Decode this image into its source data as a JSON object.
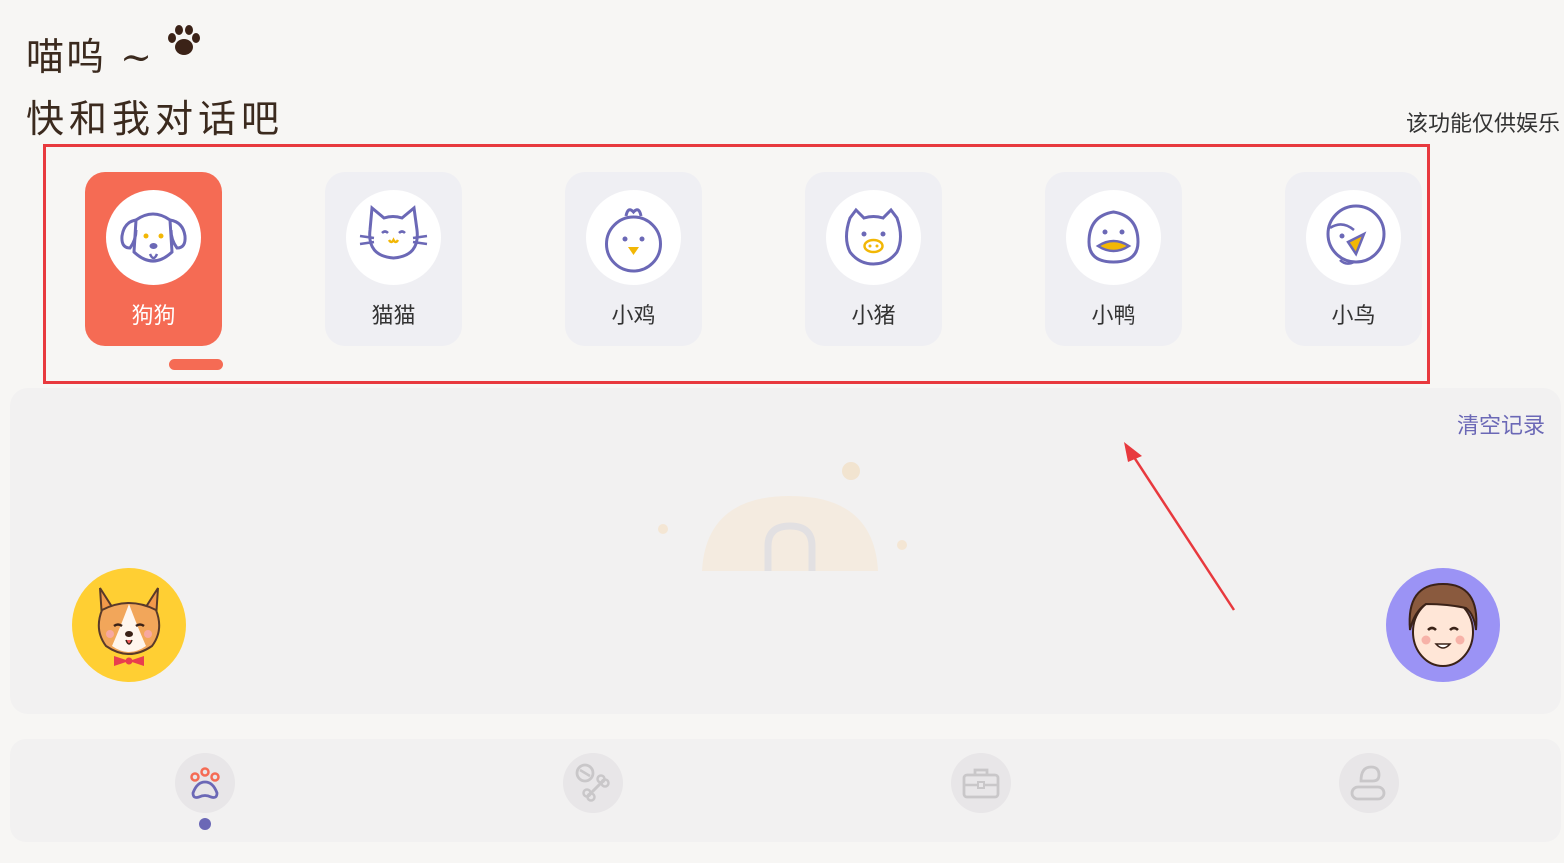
{
  "header": {
    "greeting_line1": "喵呜 ~",
    "greeting_line2": "快和我对话吧",
    "paw_icon": "paw-icon",
    "disclaimer": "该功能仅供娱乐"
  },
  "animals": [
    {
      "label": "狗狗",
      "icon": "dog-icon",
      "selected": true
    },
    {
      "label": "猫猫",
      "icon": "cat-icon",
      "selected": false
    },
    {
      "label": "小鸡",
      "icon": "chick-icon",
      "selected": false
    },
    {
      "label": "小猪",
      "icon": "pig-icon",
      "selected": false
    },
    {
      "label": "小鸭",
      "icon": "duck-icon",
      "selected": false
    },
    {
      "label": "小鸟",
      "icon": "bird-icon",
      "selected": false
    }
  ],
  "chat": {
    "clear_label": "清空记录",
    "pet_avatar": "corgi-avatar",
    "user_avatar": "user-avatar"
  },
  "tabs": [
    {
      "icon": "paw-tab-icon",
      "active": true
    },
    {
      "icon": "bone-tab-icon",
      "active": false
    },
    {
      "icon": "toolbox-tab-icon",
      "active": false
    },
    {
      "icon": "profile-tab-icon",
      "active": false
    }
  ],
  "colors": {
    "accent": "#f56b54",
    "purple": "#6b68b6",
    "highlight_frame": "#e8393e",
    "background": "#f7f6f4"
  }
}
